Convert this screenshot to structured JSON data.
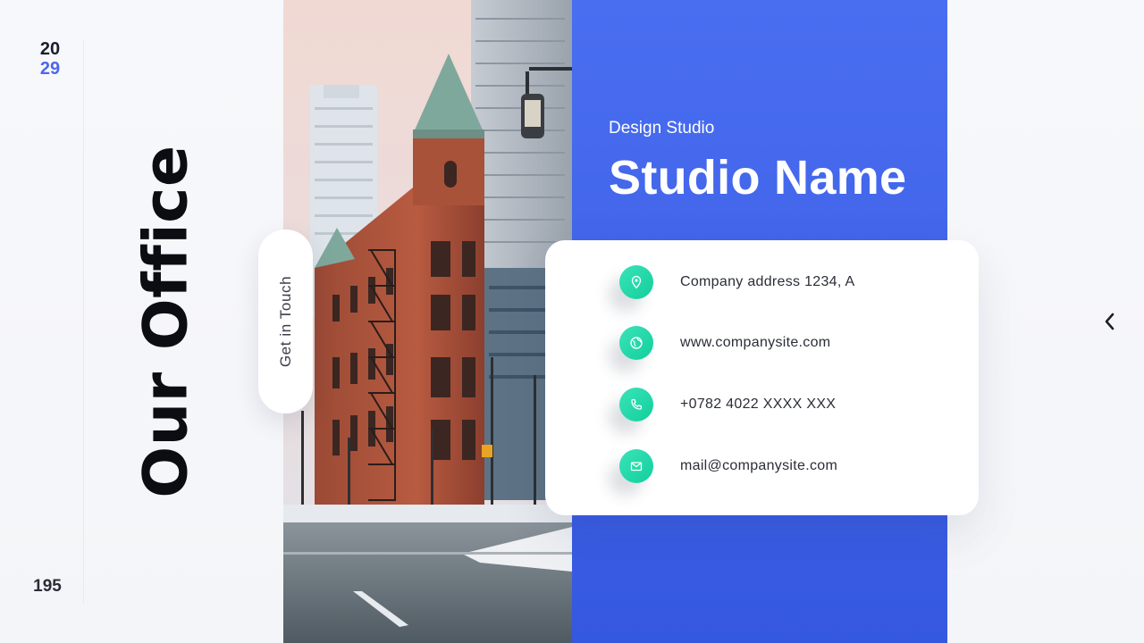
{
  "slide": {
    "year_top": "20",
    "year_bottom": "29",
    "page_number": "195",
    "title": "Our Office",
    "get_in_touch": "Get in Touch",
    "subtitle": "Design Studio",
    "studio_name": "Studio Name"
  },
  "contacts": [
    {
      "icon": "location-pin-icon",
      "text": "Company address 1234, A"
    },
    {
      "icon": "globe-icon",
      "text": "www.companysite.com"
    },
    {
      "icon": "phone-icon",
      "text": "+0782 4022 XXXX XXX"
    },
    {
      "icon": "mail-icon",
      "text": "mail@companysite.com"
    }
  ],
  "navigation": {
    "prev_icon": "chevron-left-icon"
  },
  "colors": {
    "accent_blue": "#4466ee",
    "accent_green": "#1fd6a5",
    "year_accent": "#4d67e9",
    "text_dark": "#0c0d12"
  }
}
